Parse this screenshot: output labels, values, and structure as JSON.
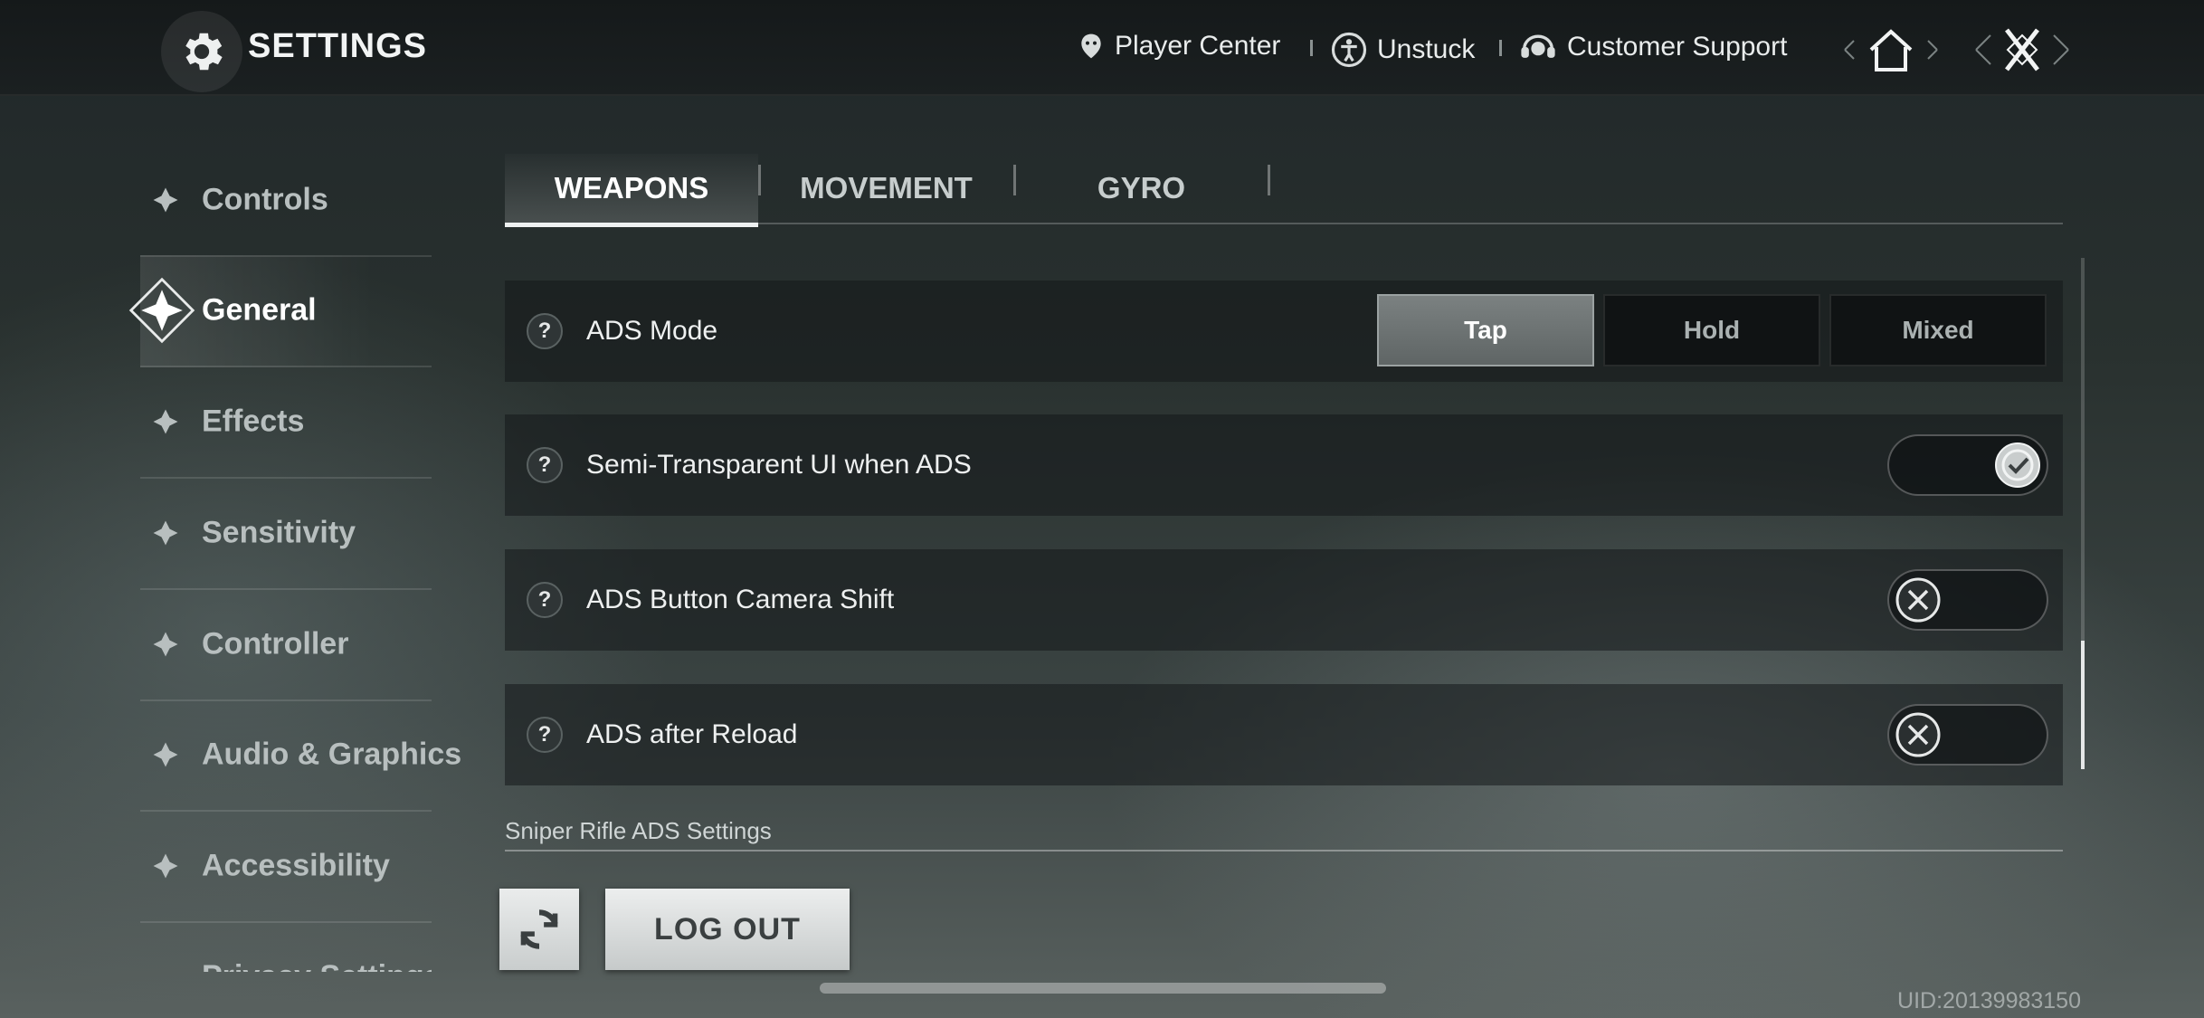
{
  "header": {
    "title": "SETTINGS",
    "links": {
      "player_center": "Player Center",
      "unstuck": "Unstuck",
      "customer_support": "Customer Support"
    }
  },
  "sidebar": {
    "items": [
      {
        "label": "Controls",
        "active": false
      },
      {
        "label": "General",
        "active": true
      },
      {
        "label": "Effects",
        "active": false
      },
      {
        "label": "Sensitivity",
        "active": false
      },
      {
        "label": "Controller",
        "active": false
      },
      {
        "label": "Audio & Graphics",
        "active": false
      },
      {
        "label": "Accessibility",
        "active": false
      },
      {
        "label": "Privacy Settings",
        "active": false
      }
    ]
  },
  "tabs": [
    {
      "label": "WEAPONS",
      "active": true
    },
    {
      "label": "MOVEMENT",
      "active": false
    },
    {
      "label": "GYRO",
      "active": false
    }
  ],
  "settings": {
    "ads_mode": {
      "label": "ADS Mode",
      "options": [
        "Tap",
        "Hold",
        "Mixed"
      ],
      "selected": "Tap"
    },
    "semi_transparent_ui": {
      "label": "Semi-Transparent UI when ADS",
      "enabled": true
    },
    "ads_camera_shift": {
      "label": "ADS Button Camera Shift",
      "enabled": false
    },
    "ads_after_reload": {
      "label": "ADS after Reload",
      "enabled": false
    },
    "help_glyph": "?"
  },
  "section": {
    "label": "Sniper Rifle ADS Settings"
  },
  "buttons": {
    "logout": "LOG OUT"
  },
  "footer": {
    "uid": "UID:20139983150"
  },
  "colors": {
    "accent": "#e6e8e8",
    "active_segment": "#6e7474"
  }
}
